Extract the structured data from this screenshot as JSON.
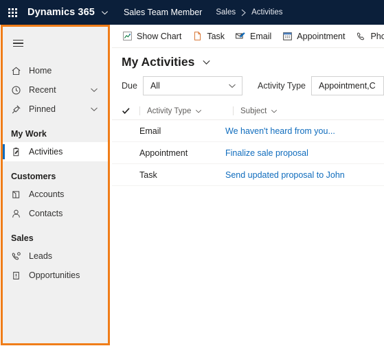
{
  "topbar": {
    "waffle_icon": "app-launcher-icon",
    "brand": "Dynamics 365",
    "brand_caret_icon": "chevron-down-icon",
    "app_name": "Sales Team Member",
    "breadcrumb": {
      "parent": "Sales",
      "separator_icon": "chevron-right-icon",
      "current": "Activities"
    }
  },
  "sidebar": {
    "hamburger_icon": "hamburger-menu-icon",
    "items": [
      {
        "label": "Home",
        "icon": "home-icon",
        "chevron": false,
        "selected": false
      },
      {
        "label": "Recent",
        "icon": "clock-icon",
        "chevron": true,
        "selected": false
      },
      {
        "label": "Pinned",
        "icon": "pin-icon",
        "chevron": true,
        "selected": false
      }
    ],
    "groups": [
      {
        "title": "My Work",
        "items": [
          {
            "label": "Activities",
            "icon": "clipboard-icon",
            "selected": true
          }
        ]
      },
      {
        "title": "Customers",
        "items": [
          {
            "label": "Accounts",
            "icon": "building-icon",
            "selected": false
          },
          {
            "label": "Contacts",
            "icon": "person-icon",
            "selected": false
          }
        ]
      },
      {
        "title": "Sales",
        "items": [
          {
            "label": "Leads",
            "icon": "lead-phone-icon",
            "selected": false
          },
          {
            "label": "Opportunities",
            "icon": "opportunity-icon",
            "selected": false
          }
        ]
      }
    ]
  },
  "commandbar": {
    "commands": [
      {
        "label": "Show Chart",
        "icon": "chart-icon"
      },
      {
        "label": "Task",
        "icon": "task-page-icon"
      },
      {
        "label": "Email",
        "icon": "email-icon"
      },
      {
        "label": "Appointment",
        "icon": "calendar-icon"
      },
      {
        "label": "Phone Call",
        "icon": "phone-icon"
      }
    ]
  },
  "view": {
    "title": "My Activities",
    "caret_icon": "chevron-down-icon"
  },
  "filters": [
    {
      "label": "Due",
      "value": "All",
      "chevron_icon": "chevron-down-icon"
    },
    {
      "label": "Activity Type",
      "value": "Appointment,C",
      "chevron_icon": "chevron-down-icon"
    }
  ],
  "grid": {
    "select_all_icon": "checkmark-icon",
    "columns": [
      {
        "label": "Activity Type",
        "sort_icon": "chevron-down-icon"
      },
      {
        "label": "Subject",
        "sort_icon": "chevron-down-icon"
      }
    ],
    "rows": [
      {
        "type": "Email",
        "subject": "We haven't heard from you..."
      },
      {
        "type": "Appointment",
        "subject": "Finalize sale proposal"
      },
      {
        "type": "Task",
        "subject": "Send updated proposal to John"
      }
    ]
  },
  "colors": {
    "topbar_bg": "#0b1f3a",
    "annotation_orange": "#f07d18",
    "sidebar_bg": "#f0f0f0",
    "link_blue": "#0f6cbd",
    "selection_blue": "#0f6cbd"
  }
}
